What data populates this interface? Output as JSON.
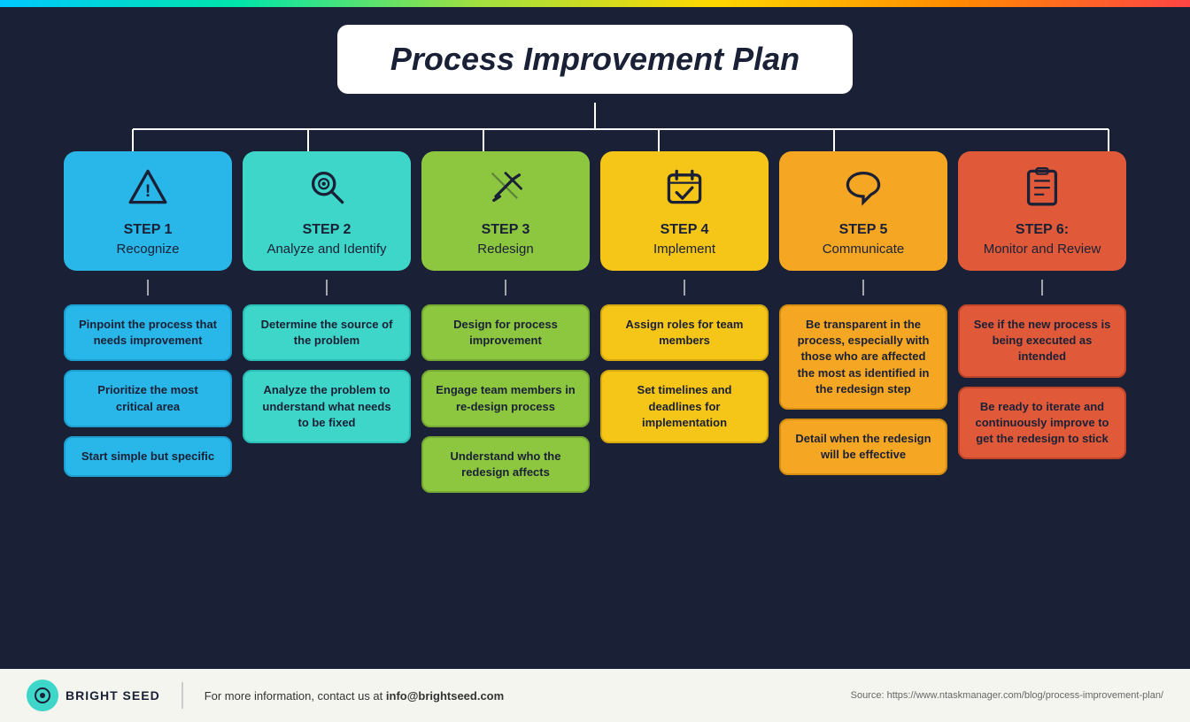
{
  "topBar": true,
  "title": "Process Improvement Plan",
  "steps": [
    {
      "id": 1,
      "label": "STEP 1",
      "name": "Recognize",
      "colorClass": "col-1",
      "subColorClass": "sub-col-1",
      "icon": "⚠",
      "subCards": [
        "Pinpoint the process that needs improvement",
        "Prioritize the most critical area",
        "Start simple but specific"
      ]
    },
    {
      "id": 2,
      "label": "STEP 2",
      "name": "Analyze and Identify",
      "colorClass": "col-2",
      "subColorClass": "sub-col-2",
      "icon": "🔍",
      "subCards": [
        "Determine the source of the problem",
        "Analyze the problem to understand what needs to be fixed"
      ]
    },
    {
      "id": 3,
      "label": "STEP 3",
      "name": "Redesign",
      "colorClass": "col-3",
      "subColorClass": "sub-col-3",
      "icon": "✏",
      "subCards": [
        "Design for process improvement",
        "Engage team members in re-design process",
        "Understand who the redesign affects"
      ]
    },
    {
      "id": 4,
      "label": "STEP 4",
      "name": "Implement",
      "colorClass": "col-4",
      "subColorClass": "sub-col-4",
      "icon": "📅",
      "subCards": [
        "Assign roles for team members",
        "Set timelines and deadlines for implementation"
      ]
    },
    {
      "id": 5,
      "label": "STEP 5",
      "name": "Communicate",
      "colorClass": "col-5",
      "subColorClass": "sub-col-5",
      "icon": "💬",
      "subCards": [
        "Be transparent in the process, especially with those who are affected the most as identified in the redesign step",
        "Detail when the redesign will be effective"
      ]
    },
    {
      "id": 6,
      "label": "STEP 6:",
      "name": "Monitor and Review",
      "colorClass": "col-6",
      "subColorClass": "sub-col-6",
      "icon": "📋",
      "subCards": [
        "See if the new process is being executed as intended",
        "Be ready to iterate and continuously improve to get the redesign to stick"
      ]
    }
  ],
  "footer": {
    "brand": "BRIGHT SEED",
    "contact_prefix": "For more information, contact us at ",
    "contact_email": "info@brightseed.com",
    "source": "Source: https://www.ntaskmanager.com/blog/process-improvement-plan/"
  }
}
